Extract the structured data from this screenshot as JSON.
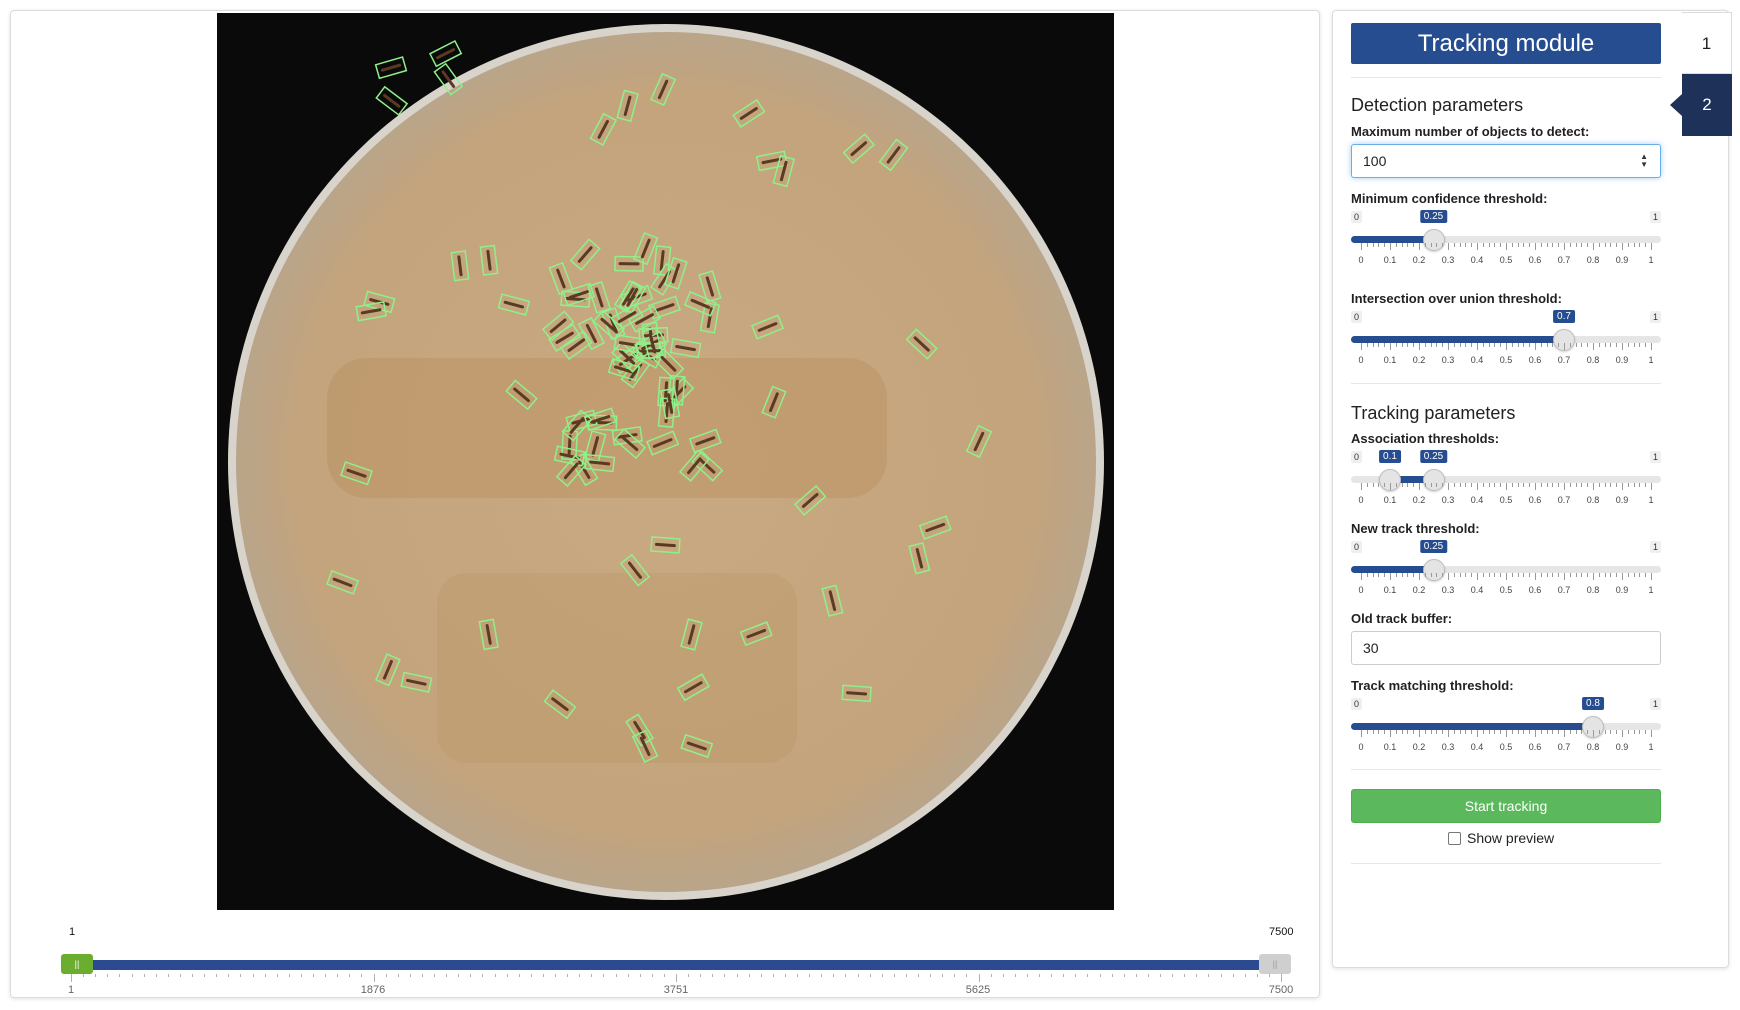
{
  "frame": {
    "min_label": "1",
    "max_label": "7500",
    "axis_labels": [
      "1",
      "1876",
      "3751",
      "5625",
      "7500"
    ],
    "range_start_fraction": 0.0,
    "range_end_fraction": 1.0
  },
  "panel": {
    "title": "Tracking module",
    "tabs": [
      "1",
      "2"
    ],
    "active_tab": "2",
    "detection": {
      "heading": "Detection parameters",
      "max_objects_label": "Maximum number of objects to detect:",
      "max_objects_value": "100",
      "confidence": {
        "label": "Minimum confidence threshold:",
        "min": "0",
        "max": "1",
        "value": 0.25,
        "value_text": "0.25"
      },
      "iou": {
        "label": "Intersection over union threshold:",
        "min": "0",
        "max": "1",
        "value": 0.7,
        "value_text": "0.7"
      }
    },
    "tracking": {
      "heading": "Tracking parameters",
      "association": {
        "label": "Association thresholds:",
        "min": "0",
        "max": "1",
        "low": 0.1,
        "low_text": "0.1",
        "high": 0.25,
        "high_text": "0.25"
      },
      "new_track": {
        "label": "New track threshold:",
        "min": "0",
        "max": "1",
        "value": 0.25,
        "value_text": "0.25"
      },
      "old_buffer_label": "Old track buffer:",
      "old_buffer_value": "30",
      "matching": {
        "label": "Track matching threshold:",
        "min": "0",
        "max": "1",
        "value": 0.8,
        "value_text": "0.8"
      }
    },
    "tick_labels": [
      "0",
      "0.1",
      "0.2",
      "0.3",
      "0.4",
      "0.5",
      "0.6",
      "0.7",
      "0.8",
      "0.9",
      "1"
    ],
    "start_label": "Start tracking",
    "preview_label": "Show preview",
    "preview_checked": false
  },
  "colors": {
    "primary": "#274d91",
    "tab_active": "#1e3158",
    "success": "#5cb85c",
    "frame_handle": "#6aad2f",
    "box_outline": "#8ff08a",
    "dish": "#c4a47c"
  },
  "icons": {
    "number_spinner": "spinner-icon",
    "frame_handle": "grip-icon"
  }
}
